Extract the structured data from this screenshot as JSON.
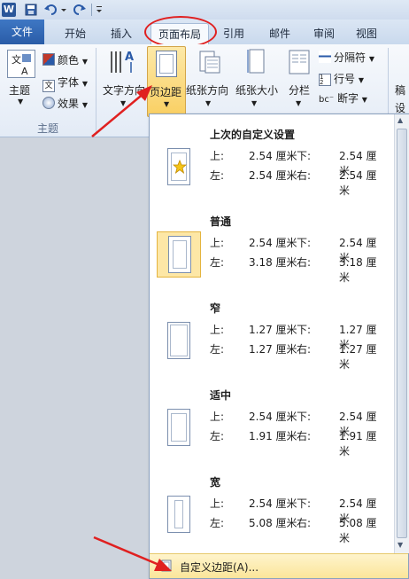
{
  "qat": {
    "app_icon_letter": "W"
  },
  "tabs": [
    {
      "key": "file",
      "label": "文件"
    },
    {
      "key": "home",
      "label": "开始"
    },
    {
      "key": "insert",
      "label": "插入"
    },
    {
      "key": "layout",
      "label": "页面布局"
    },
    {
      "key": "ref",
      "label": "引用"
    },
    {
      "key": "mail",
      "label": "邮件"
    },
    {
      "key": "review",
      "label": "审阅"
    },
    {
      "key": "view",
      "label": "视图"
    }
  ],
  "ribbon": {
    "theme": {
      "label": "主题",
      "colors": "颜色",
      "fonts": "字体",
      "effects": "效果",
      "group_label": "主题"
    },
    "text_direction": "文字方向",
    "margins": "页边距",
    "orientation": "纸张方向",
    "size": "纸张大小",
    "columns": "分栏",
    "breaks": "分隔符",
    "line_numbers": "行号",
    "hyphenation": "断字",
    "draft_partial_1": "稿",
    "draft_partial_2": "设"
  },
  "gallery": {
    "items": [
      {
        "name": "上次的自定义设置",
        "top": "2.54 厘米",
        "bottom": "2.54 厘米",
        "left": "2.54 厘米",
        "right": "2.54 厘米"
      },
      {
        "name": "普通",
        "top": "2.54 厘米",
        "bottom": "2.54 厘米",
        "left": "3.18 厘米",
        "right": "3.18 厘米"
      },
      {
        "name": "窄",
        "top": "1.27 厘米",
        "bottom": "1.27 厘米",
        "left": "1.27 厘米",
        "right": "1.27 厘米"
      },
      {
        "name": "适中",
        "top": "2.54 厘米",
        "bottom": "2.54 厘米",
        "left": "1.91 厘米",
        "right": "1.91 厘米"
      },
      {
        "name": "宽",
        "top": "2.54 厘米",
        "bottom": "2.54 厘米",
        "left": "5.08 厘米",
        "right": "5.08 厘米"
      }
    ],
    "labels": {
      "top": "上:",
      "bottom": "下:",
      "left": "左:",
      "right": "右:"
    },
    "custom": "自定义边距(A)..."
  }
}
